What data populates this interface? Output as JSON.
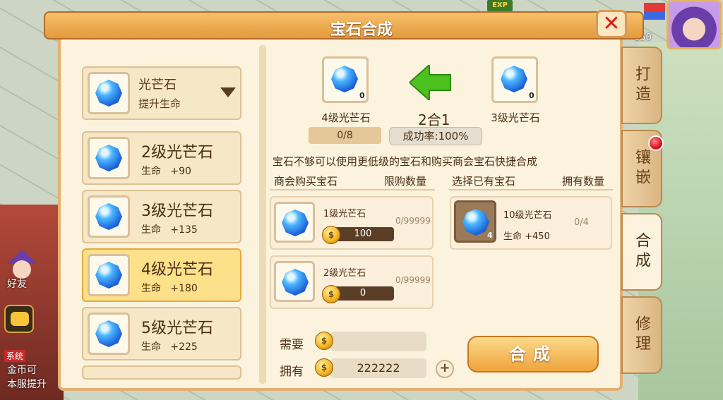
{
  "window": {
    "title": "宝石合成",
    "close": "✕"
  },
  "hud": {
    "exp_label": "EXP",
    "level": "150"
  },
  "selector": {
    "name": "光芒石",
    "attr": "提升生命"
  },
  "gem_list": [
    {
      "name": "2级光芒石",
      "attr": "生命",
      "value": "+90"
    },
    {
      "name": "3级光芒石",
      "attr": "生命",
      "value": "+135"
    },
    {
      "name": "4级光芒石",
      "attr": "生命",
      "value": "+180"
    },
    {
      "name": "5级光芒石",
      "attr": "生命",
      "value": "+225"
    }
  ],
  "combine": {
    "target": {
      "name": "4级光芒石",
      "count": "0"
    },
    "source": {
      "name": "3级光芒石",
      "count": "0"
    },
    "formula": "2合1",
    "progress": "0/8",
    "rate": "成功率:100%",
    "hint": "宝石不够可以使用更低级的宝石和购买商会宝石快捷合成"
  },
  "shop": {
    "header": "商会购买宝石",
    "limit_header": "限购数量",
    "items": [
      {
        "name": "1级光芒石",
        "limit": "0/99999",
        "price": "100"
      },
      {
        "name": "2级光芒石",
        "limit": "0/99999",
        "price": "0"
      }
    ]
  },
  "owned": {
    "header": "选择已有宝石",
    "count_header": "拥有数量",
    "items": [
      {
        "name": "10级光芒石",
        "count": "0/4",
        "attr": "生命 +450",
        "badge": "4"
      }
    ]
  },
  "cost": {
    "need_label": "需要",
    "need_value": "",
    "have_label": "拥有",
    "have_value": "222222",
    "plus": "+"
  },
  "combine_button": "合成",
  "tabs": [
    {
      "label": "打造"
    },
    {
      "label": "镶嵌"
    },
    {
      "label": "合成"
    },
    {
      "label": "修理"
    }
  ],
  "sidebar": {
    "friend": "好友",
    "sys_tag": "系统",
    "sys_lines": [
      "金币可",
      "本服提升"
    ]
  }
}
